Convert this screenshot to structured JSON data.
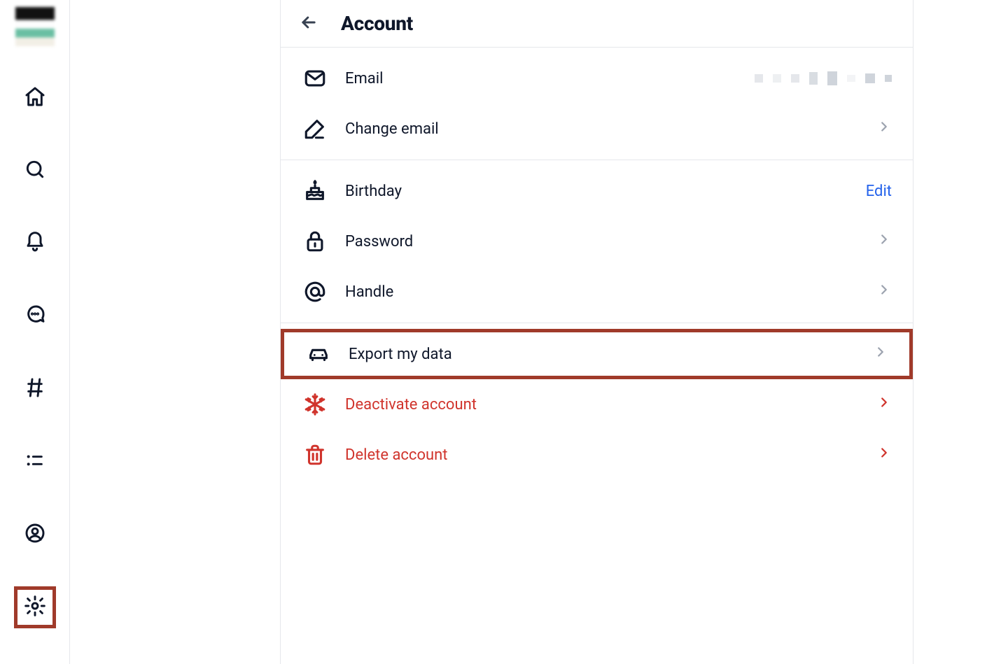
{
  "sidebar": {
    "items": [
      {
        "name": "home"
      },
      {
        "name": "search"
      },
      {
        "name": "notifications"
      },
      {
        "name": "chat"
      },
      {
        "name": "feeds"
      },
      {
        "name": "lists"
      },
      {
        "name": "profile"
      },
      {
        "name": "settings",
        "active": true
      }
    ]
  },
  "header": {
    "title": "Account"
  },
  "groups": [
    {
      "items": [
        {
          "key": "email",
          "icon": "mail-icon",
          "label": "Email",
          "value_obscured": true,
          "right": "value"
        },
        {
          "key": "change-email",
          "icon": "pencil-icon",
          "label": "Change email",
          "right": "chevron"
        }
      ]
    },
    {
      "items": [
        {
          "key": "birthday",
          "icon": "cake-icon",
          "label": "Birthday",
          "right": "action",
          "action_label": "Edit"
        },
        {
          "key": "password",
          "icon": "lock-icon",
          "label": "Password",
          "right": "chevron"
        },
        {
          "key": "handle",
          "icon": "at-icon",
          "label": "Handle",
          "right": "chevron"
        }
      ]
    },
    {
      "items": [
        {
          "key": "export",
          "icon": "car-icon",
          "label": "Export my data",
          "right": "chevron",
          "highlight": true
        },
        {
          "key": "deactivate",
          "icon": "snowflake-icon",
          "label": "Deactivate account",
          "right": "chevron",
          "danger": true
        },
        {
          "key": "delete",
          "icon": "trash-icon",
          "label": "Delete account",
          "right": "chevron",
          "danger": true
        }
      ]
    }
  ],
  "colors": {
    "link": "#2563eb",
    "danger": "#d0342c",
    "highlight_border": "#a03a2a"
  }
}
